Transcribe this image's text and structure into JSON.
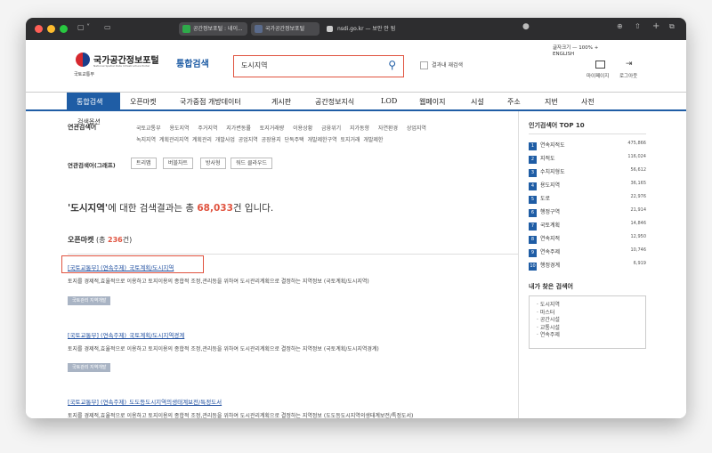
{
  "browser": {
    "tabs": [
      "공간정보포털 : 네이...",
      "국가공간정보포털"
    ],
    "url": "nsdi.go.kr — 보안 안 됨"
  },
  "header": {
    "logo_title": "국가공간정보포털",
    "logo_sub": "National Spatial Data Infrastructure Portal",
    "ministry": "국토교통부",
    "integrated": "통합검색",
    "search_value": "도시지역",
    "within": "결과내 재검색",
    "font_size": "글자크기 — 100% +",
    "english": "ENGLISH",
    "mypage": "마이페이지",
    "logout": "로그아웃"
  },
  "nav": [
    "통합검색",
    "오픈마켓",
    "국가중점 개방데이터",
    "게시판",
    "공간정보지식",
    "LOD",
    "웹페이지",
    "시설",
    "주소",
    "지번",
    "사전"
  ],
  "related": {
    "label": "연관검색어",
    "overlap": "검색옵션",
    "row1": [
      "국토교통부",
      "용도지역",
      "주거지역",
      "지가변동률",
      "토지거래량",
      "이용상황",
      "금융위기",
      "지가동향",
      "자연환경",
      "상업지역"
    ],
    "row2": [
      "녹지지역",
      "계획관리지역",
      "계획관리",
      "개발사업",
      "공업지역",
      "공장용지",
      "단독주택",
      "개발제한구역",
      "토지거래",
      "개발제한"
    ],
    "graph_label": "연관검색어(그래프)",
    "graph_chips": [
      "트리맵",
      "버블차트",
      "방사형",
      "워드 클라우드"
    ]
  },
  "summary": {
    "pre": "'도시지역'",
    "mid": "에 대한 검색결과는 총 ",
    "count": "68,033",
    "post": "건 입니다."
  },
  "market": {
    "title": "오픈마켓",
    "pre": " (총 ",
    "count": "236",
    "post": "건)"
  },
  "results": [
    {
      "title": "[국토교통부] (연속주제)_국토계획/도시지역",
      "desc": "토지를 경제적,효율적으로 이용하고 토지이용의 종합적 조정,관리등을 위하여 도시관리계획으로 결정하는 지역정보 (국토계획/도시지역)",
      "tag": "국토관리 지역개발"
    },
    {
      "title": "[국토교통부] (연속주제)_국토계획/도시지역경계",
      "desc": "토지를 경제적,효율적으로 이용하고 토지이용의 종합적 조정,관리등을 위하여 도시관리계획으로 결정하는 지역정보 (국토계획/도시지역경계)",
      "tag": "국토관리 지역개발"
    },
    {
      "title": "[국토교통부] (연속주제)_도도등도시지역의생태계보전/특정도서",
      "desc": "토지를 경제적,효율적으로 이용하고 토지이용의 종합적 조정,관리등을 위하여 도시관리계획으로 결정하는 지역정보 (도도등도시지역의생태계보전/특정도서)",
      "tag": ""
    }
  ],
  "top10": {
    "title": "인기검색어 TOP 10",
    "items": [
      {
        "rank": "1",
        "name": "연속지적도",
        "count": "475,866"
      },
      {
        "rank": "2",
        "name": "지적도",
        "count": "116,024"
      },
      {
        "rank": "3",
        "name": "수치지형도",
        "count": "56,612"
      },
      {
        "rank": "4",
        "name": "용도지역",
        "count": "36,165"
      },
      {
        "rank": "5",
        "name": "도로",
        "count": "22,976"
      },
      {
        "rank": "6",
        "name": "행정구역",
        "count": "21,914"
      },
      {
        "rank": "7",
        "name": "국토계획",
        "count": "14,846"
      },
      {
        "rank": "8",
        "name": "연속지적",
        "count": "12,950"
      },
      {
        "rank": "9",
        "name": "연속주제",
        "count": "10,746"
      },
      {
        "rank": "10",
        "name": "행정경계",
        "count": "6,919"
      }
    ]
  },
  "my_searches": {
    "title": "내가 찾은 검색어",
    "items": [
      "도시지역",
      "마스터",
      "공간시설",
      "교통시설",
      "연속주제"
    ]
  }
}
